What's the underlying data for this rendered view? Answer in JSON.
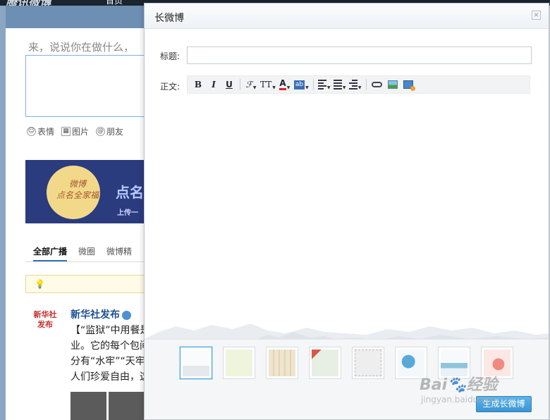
{
  "background": {
    "brand": "腾讯微博",
    "nav_home": "首页",
    "compose_prompt": "来，说说你在做什么，",
    "tools": [
      {
        "icon": "emoji-icon",
        "label": "表情"
      },
      {
        "icon": "image-icon",
        "label": "图片"
      },
      {
        "icon": "at-icon",
        "label": "朋友"
      }
    ],
    "banner": {
      "moon_text_1": "微博",
      "moon_text_2": "点名全家福",
      "side_text": "点名",
      "side_sub": "上传一"
    },
    "tabs": [
      "全部广播",
      "微圈",
      "微博精"
    ],
    "news": {
      "logo_line1": "新华社",
      "logo_line2": "发布",
      "name": "新华社发布",
      "lines": [
        "【“监狱”中用餐是",
        "业。它的每个包间",
        "分有“水牢”“天牢",
        "人们珍爱自由，这"
      ]
    }
  },
  "dialog": {
    "title": "长微博",
    "close_label": "×",
    "title_label": "标题:",
    "title_value": "",
    "body_label": "正文:",
    "toolbar": {
      "bold": "B",
      "italic": "I",
      "underline": "U",
      "font_family": "ℱ",
      "font_size": "TT",
      "font_color": "A",
      "highlight": "ab"
    },
    "skins": [
      {
        "name": "plain",
        "color": "#f4f6f8",
        "selected": true
      },
      {
        "name": "green-flower",
        "color": "#eef5dc",
        "selected": false
      },
      {
        "name": "beige-pattern",
        "color": "#efe4cf",
        "selected": false
      },
      {
        "name": "red-stripe",
        "color": "#e7eee4",
        "selected": false
      },
      {
        "name": "postage",
        "color": "#eeeeee",
        "selected": false
      },
      {
        "name": "blue-robot",
        "color": "#dde9f4",
        "selected": false
      },
      {
        "name": "fox-lake",
        "color": "#eaf2f7",
        "selected": false
      },
      {
        "name": "red-tree",
        "color": "#fbe8e4",
        "selected": false
      }
    ],
    "generate_button": "生成长微博"
  },
  "watermark": {
    "main": "Bai🐾经验",
    "sub": "jingyan.baidu.com"
  }
}
